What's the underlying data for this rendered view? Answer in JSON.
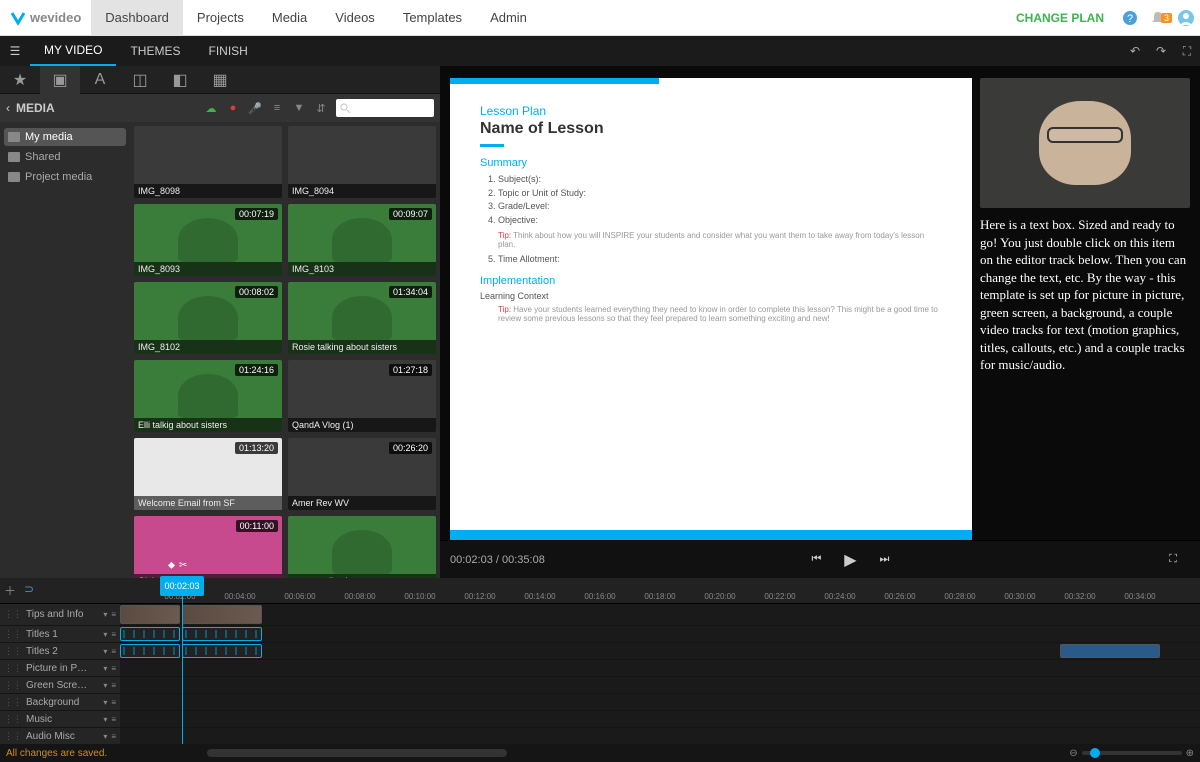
{
  "brand": "wevideo",
  "topnav": [
    "Dashboard",
    "Projects",
    "Media",
    "Videos",
    "Templates",
    "Admin"
  ],
  "topnav_active": 0,
  "change_plan": "CHANGE PLAN",
  "notif_count": "3",
  "subtabs": [
    "MY VIDEO",
    "THEMES",
    "FINISH"
  ],
  "subtabs_active": 0,
  "media_header": "MEDIA",
  "folders": [
    {
      "name": "My media",
      "active": true
    },
    {
      "name": "Shared",
      "active": false
    },
    {
      "name": "Project media",
      "active": false
    }
  ],
  "clips": [
    {
      "name": "IMG_8098",
      "dur": "",
      "cls": "dark"
    },
    {
      "name": "IMG_8094",
      "dur": "",
      "cls": "dark"
    },
    {
      "name": "IMG_8093",
      "dur": "00:07:19",
      "cls": ""
    },
    {
      "name": "IMG_8103",
      "dur": "00:09:07",
      "cls": ""
    },
    {
      "name": "IMG_8102",
      "dur": "00:08:02",
      "cls": ""
    },
    {
      "name": "Rosie talking about sisters",
      "dur": "01:34:04",
      "cls": ""
    },
    {
      "name": "Elli talkig about sisters",
      "dur": "01:24:16",
      "cls": ""
    },
    {
      "name": "QandA Vlog (1)",
      "dur": "01:27:18",
      "cls": "dark"
    },
    {
      "name": "Welcome Email from SF",
      "dur": "01:13:20",
      "cls": "white"
    },
    {
      "name": "Amer Rev WV",
      "dur": "00:26:20",
      "cls": "dark"
    },
    {
      "name": "Global Warming",
      "dur": "00:11:00",
      "cls": "pink"
    },
    {
      "name": "green wall paint",
      "dur": "",
      "cls": ""
    }
  ],
  "slide": {
    "lesson_plan": "Lesson Plan",
    "name": "Name of Lesson",
    "summary": "Summary",
    "items": [
      "Subject(s):",
      "Topic or Unit of Study:",
      "Grade/Level:",
      "Objective:"
    ],
    "tip1": "Think about how you will INSPIRE your students and consider what you want them to take away from today's lesson plan.",
    "item5": "Time Allotment:",
    "impl": "Implementation",
    "lc": "Learning Context",
    "tip2": "Have your students learned everything they need to know in order to complete this lesson? This might be a good time to review some previous lessons so that they feel prepared to learn something exciting and new!"
  },
  "textbox": "Here is a text box. Sized and ready to go! You just double click on this item on the editor track below. Then you can change the text, etc. By the way - this template is set up for picture in picture, green screen, a background, a couple video tracks for text (motion graphics, titles, callouts, etc.) and a couple tracks for music/audio.",
  "time_current": "00:02:03",
  "time_total": "00:35:08",
  "ruler_ticks": [
    "00:02:00",
    "00:04:00",
    "00:06:00",
    "00:08:00",
    "00:10:00",
    "00:12:00",
    "00:14:00",
    "00:16:00",
    "00:18:00",
    "00:20:00",
    "00:22:00",
    "00:24:00",
    "00:26:00",
    "00:28:00",
    "00:30:00",
    "00:32:00",
    "00:34:00"
  ],
  "playhead": "00:02:03",
  "tracks": [
    "Tips and Info",
    "Titles 1",
    "Titles 2",
    "Picture in P…",
    "Green Scre…",
    "Background",
    "Music",
    "Audio Misc"
  ],
  "status": "All changes are saved."
}
